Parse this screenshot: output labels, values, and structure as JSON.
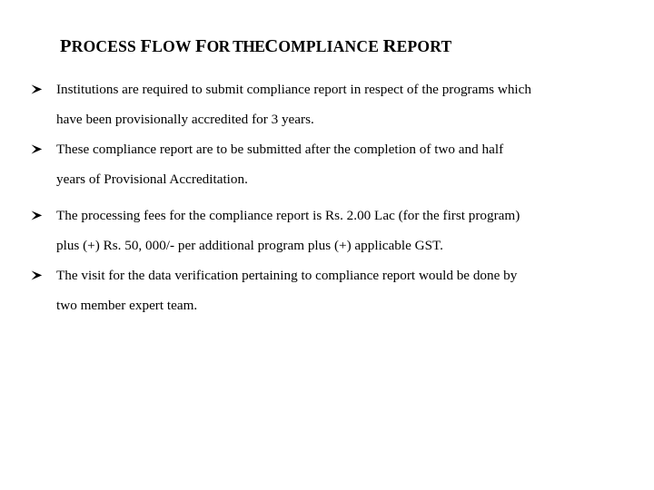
{
  "document": {
    "background_color": "#ffffff",
    "text_color": "#000000",
    "title": {
      "full_text": "PROCESS FLOW FOR THE COMPLIANCE REPORT",
      "segments": [
        {
          "cap": "P",
          "rest": "ROCESS"
        },
        {
          "cap": "F",
          "rest": "LOW"
        },
        {
          "cap": "F",
          "rest": "OR"
        },
        {
          "cap": "T",
          "rest": "HE"
        },
        {
          "cap": "C",
          "rest": "OMPLIANCE"
        },
        {
          "cap": "R",
          "rest": "EPORT"
        }
      ],
      "part_1": "P",
      "part_2": "ROCESS ",
      "part_3": "F",
      "part_4": "LOW ",
      "part_5": "F",
      "part_6": "OR T",
      "part_7": "HE",
      "part_8": "C",
      "part_9": "OMPLIANCE ",
      "part_10": "R",
      "part_11": "EPORT"
    },
    "bullet_marker": "arrow-head",
    "bullets": [
      {
        "id": "bullet-1",
        "marker": "➢",
        "text": "Institutions are required to submit compliance report in respect of the programs which have been provisionally accredited for 3 years.",
        "line_1": "Institutions are required to submit compliance report in respect of the programs which",
        "line_2": "have been provisionally accredited for 3 years.",
        "justified": false
      },
      {
        "id": "bullet-2",
        "marker": "➢",
        "text": "These compliance report are to be submitted after the completion of two and half years of Provisional Accreditation.",
        "line_1": "These compliance report are to be submitted after the completion of two and half",
        "line_2": "years of Provisional Accreditation.",
        "justified": true
      },
      {
        "id": "bullet-3",
        "marker": "➢",
        "text": "The processing fees for the compliance report is Rs. 2.00 Lac (for the first program) plus (+) Rs. 50, 000/- per additional program plus (+) applicable GST.",
        "line_1": "The processing fees for the compliance report is Rs. 2.00 Lac (for the first program)",
        "line_2": "plus (+) Rs. 50, 000/- per additional program plus (+) applicable GST.",
        "justified": true
      },
      {
        "id": "bullet-4",
        "marker": "➢",
        "text": "The visit for the data verification pertaining to compliance report would be done by two member expert team.",
        "line_1": "The visit for the data verification pertaining to compliance report would be done by",
        "line_2": "two member expert team.",
        "justified": true
      }
    ]
  }
}
